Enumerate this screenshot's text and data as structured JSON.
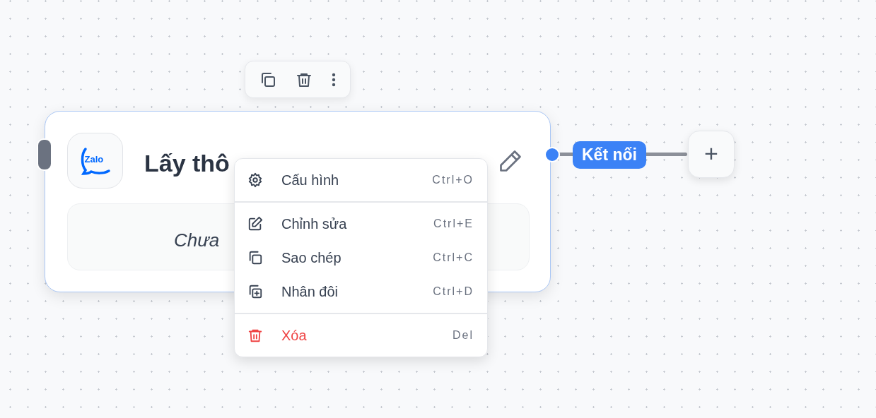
{
  "node": {
    "logo_text": "Zalo",
    "title": "Lấy thô",
    "body_text": "Chưa",
    "selected": true
  },
  "connection": {
    "label": "Kết nối"
  },
  "add_button": {
    "label": "+"
  },
  "context_menu": {
    "groups": [
      [
        {
          "label": "Cấu hình",
          "shortcut": "Ctrl+O",
          "kind": "settings",
          "danger": false
        }
      ],
      [
        {
          "label": "Chỉnh sửa",
          "shortcut": "Ctrl+E",
          "kind": "edit",
          "danger": false
        },
        {
          "label": "Sao chép",
          "shortcut": "Ctrl+C",
          "kind": "copy",
          "danger": false
        },
        {
          "label": "Nhân đôi",
          "shortcut": "Ctrl+D",
          "kind": "duplicate",
          "danger": false
        }
      ],
      [
        {
          "label": "Xóa",
          "shortcut": "Del",
          "kind": "delete",
          "danger": true
        }
      ]
    ]
  }
}
